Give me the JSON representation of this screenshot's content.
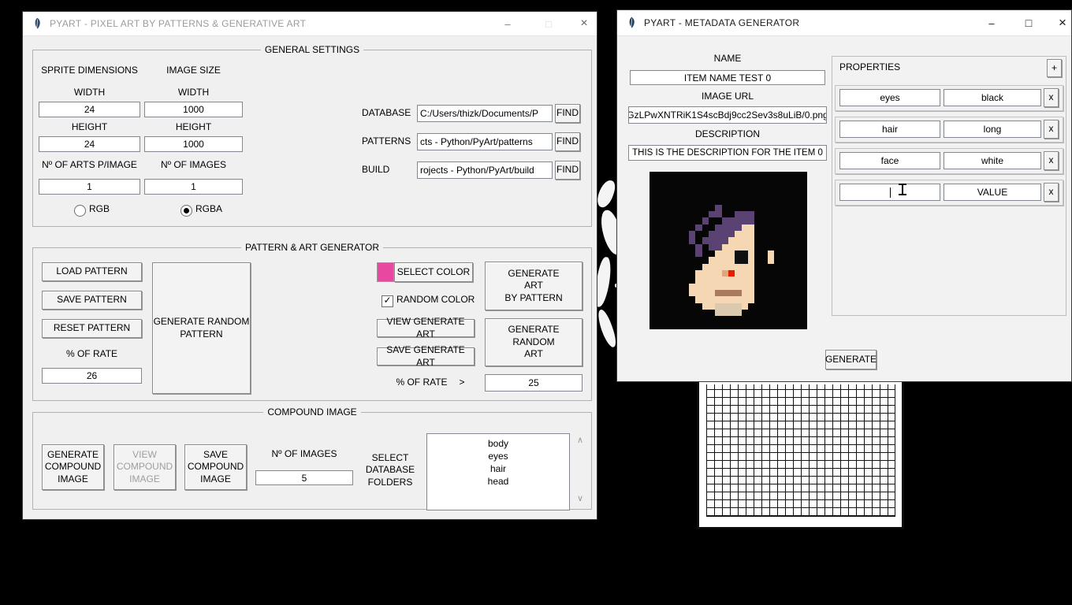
{
  "left_window": {
    "title": "PYART - PIXEL ART BY PATTERNS & GENERATIVE ART",
    "controls": {
      "minimize": "–",
      "maximize": "□",
      "close": "×"
    },
    "general": {
      "legend": "GENERAL SETTINGS",
      "sprite_dimensions_label": "SPRITE DIMENSIONS",
      "image_size_label": "IMAGE SIZE",
      "width_label": "WIDTH",
      "height_label": "HEIGHT",
      "sprite_width": "24",
      "sprite_height": "24",
      "image_width": "1000",
      "image_height": "1000",
      "arts_per_image_label": "Nº OF ARTS P/IMAGE",
      "arts_per_image": "1",
      "n_images_label": "Nº OF IMAGES",
      "n_images": "1",
      "rgb_label": "RGB",
      "rgba_label": "RGBA",
      "selected_color_mode": "RGBA",
      "paths": [
        {
          "label": "DATABASE",
          "value": "C:/Users/thizk/Documents/P",
          "button": "FIND"
        },
        {
          "label": "PATTERNS",
          "value": "cts - Python/PyArt/patterns",
          "button": "FIND"
        },
        {
          "label": "BUILD",
          "value": "rojects - Python/PyArt/build",
          "button": "FIND"
        }
      ]
    },
    "pattern": {
      "legend": "PATTERN & ART GENERATOR",
      "load_button": "LOAD PATTERN",
      "save_button": "SAVE PATTERN",
      "reset_button": "RESET PATTERN",
      "rate_label": "% OF RATE",
      "rate_value": "26",
      "random_pattern_button": "GENERATE RANDOM\nPATTERN",
      "select_color_button": "SELECT COLOR",
      "swatch_color": "#e8489f",
      "random_color_label": "RANDOM COLOR",
      "random_color_checked": true,
      "checkmark": "✓",
      "view_art_button": "VIEW GENERATE ART",
      "save_art_button": "SAVE GENERATE ART",
      "art_by_pattern_button": "GENERATE\nART\nBY PATTERN",
      "random_art_button": "GENERATE\nRANDOM\nART",
      "rate2_label": "% OF RATE",
      "gt_label": ">",
      "rate2_value": "25"
    },
    "compound": {
      "legend": "COMPOUND IMAGE",
      "generate_button": "GENERATE\nCOMPOUND\nIMAGE",
      "view_button": "VIEW\nCOMPOUND\nIMAGE",
      "save_button": "SAVE\nCOMPOUND\nIMAGE",
      "n_images_label": "Nº OF IMAGES",
      "n_images": "5",
      "select_db_label": "SELECT\nDATABASE\nFOLDERS",
      "folders": [
        "body",
        "eyes",
        "hair",
        "head"
      ],
      "scroll_up": "∧",
      "scroll_down": "∨"
    }
  },
  "right_window": {
    "title": "PYART - METADATA GENERATOR",
    "controls": {
      "minimize": "–",
      "maximize": "□",
      "close": "×"
    },
    "fields": {
      "name_label": "NAME",
      "name_value": "ITEM NAME TEST 0",
      "url_label": "IMAGE URL",
      "url_value": "GzLPwXNTRiK1S4scBdj9cc2Sev3s8uLiB/0.png",
      "desc_label": "DESCRIPTION",
      "desc_value": "THIS IS THE DESCRIPTION FOR THE ITEM 0"
    },
    "generate_button": "GENERATE",
    "properties": {
      "label": "PROPERTIES",
      "add_button": "+",
      "rows": [
        {
          "key": "eyes",
          "value": "black",
          "remove": "x"
        },
        {
          "key": "hair",
          "value": "long",
          "remove": "x"
        },
        {
          "key": "face",
          "value": "white",
          "remove": "x"
        },
        {
          "key": "",
          "value": "VALUE",
          "remove": "x"
        }
      ]
    },
    "pixel_art": {
      "palette": {
        ".": "#060606",
        "P": "#5a4272",
        "S": "#f6d7b3",
        "E": "#101010",
        "N": "#dfa77c",
        "R": "#e81c00",
        "M": "#aa7a5e",
        "T": "#dccab0"
      },
      "rows": [
        "........................",
        "........................",
        "........................",
        "........................",
        "........................",
        "..........P.............",
        ".........PP..PPP........",
        "........P..PPPPP........",
        ".......P..PPPPSS........",
        "......P..PPPPSSS........",
        "......P.PPPPSSSS........",
        ".......P.PPSSSSS........",
        ".......P..SSSEES..S.....",
        ".........SSSSEES..S.....",
        "........SSSSSSSS........",
        ".......SSSSNRSSS........",
        ".......SSSSSSSSS........",
        "......SSSSSSSSSS........",
        "......SSSSMMMMSS........",
        ".......SSSSSSSSS........",
        "........SSTTTTS.........",
        "..........TTTT..........",
        "........................",
        "........................"
      ]
    }
  }
}
